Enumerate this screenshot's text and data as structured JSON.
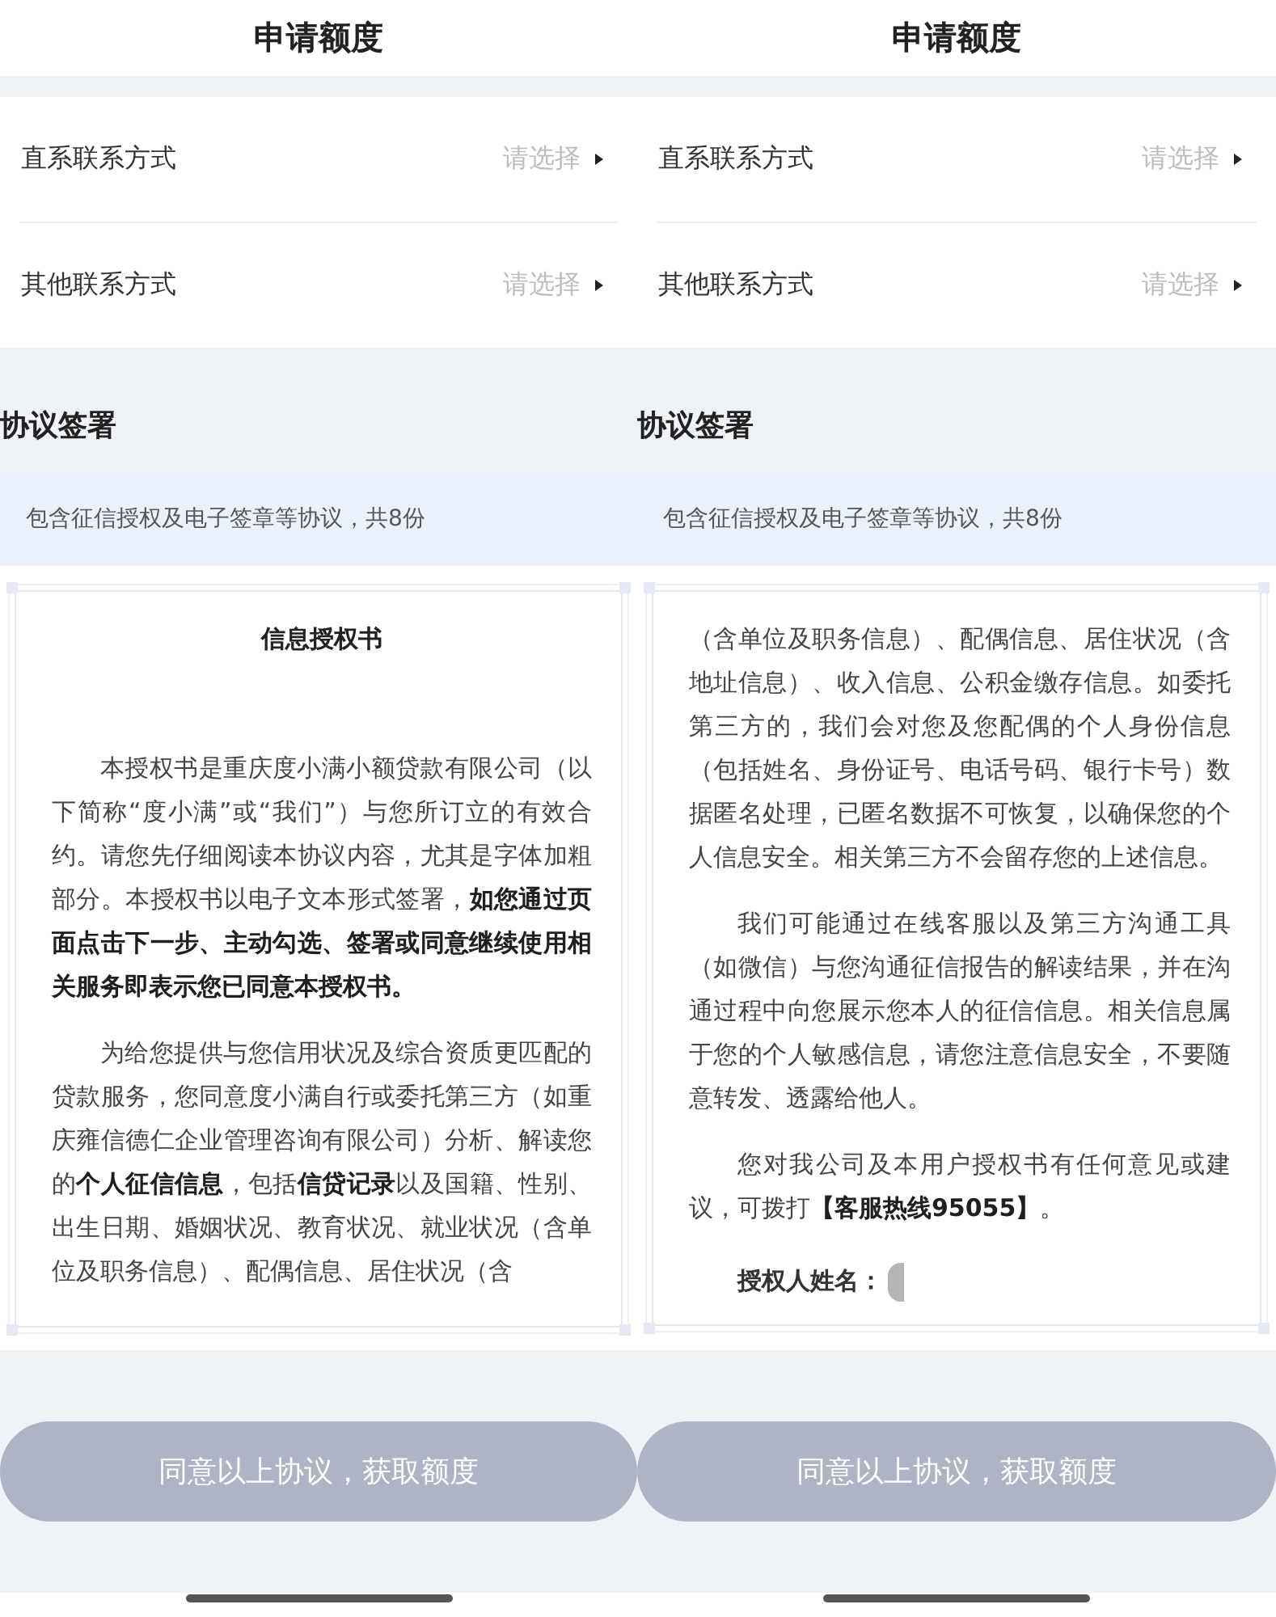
{
  "screens": [
    {
      "title": "申请额度",
      "contact_rows": [
        {
          "label": "直系联系方式",
          "placeholder": "请选择"
        },
        {
          "label": "其他联系方式",
          "placeholder": "请选择"
        }
      ],
      "section_title": "协议签署",
      "agreement_note": "包含征信授权及电子签章等协议，共8份",
      "document": {
        "title": "信息授权书",
        "paragraphs": [
          {
            "kind": "indented",
            "text": "本授权书是重庆度小满小额贷款有限公司（以下简称“度小满”或“我们”）与您所订立的有效合约。请您先仔细阅读本协议内容，尤其是字体加粗部分。本授权书以电子文本形式签署，**如您通过页面点击下一步、主动勾选、签署或同意继续使用相关服务即表示您已同意本授权书。**"
          },
          {
            "kind": "indented",
            "text": "为给您提供与您信用状况及综合资质更匹配的贷款服务，您同意度小满自行或委托第三方（如重庆雍信德仁企业管理咨询有限公司）分析、解读您的**个人征信信息**，包括**信贷记录**以及国籍、性别、出生日期、婚姻状况、教育状况、就业状况（含单位及职务信息）、配偶信息、居住状况（含"
          }
        ]
      },
      "submit_button": {
        "label": "同意以上协议，获取额度",
        "disabled": true
      }
    },
    {
      "title": "申请额度",
      "contact_rows": [
        {
          "label": "直系联系方式",
          "placeholder": "请选择"
        },
        {
          "label": "其他联系方式",
          "placeholder": "请选择"
        }
      ],
      "section_title": "协议签署",
      "agreement_note": "包含征信授权及电子签章等协议，共8份",
      "document": {
        "paragraphs": [
          {
            "kind": "continued",
            "text": "（含单位及职务信息）、配偶信息、居住状况（含地址信息）、收入信息、公积金缴存信息。如委托第三方的，我们会对您及您配偶的个人身份信息（包括姓名、身份证号、电话号码、银行卡号）数据匿名处理，已匿名数据不可恢复，以确保您的个人信息安全。相关第三方不会留存您的上述信息。"
          },
          {
            "kind": "indented",
            "text": "我们可能通过在线客服以及第三方沟通工具（如微信）与您沟通征信报告的解读结果，并在沟通过程中向您展示您本人的征信信息。相关信息属于您的个人敏感信息，请您注意信息安全，不要随意转发、透露给他人。"
          },
          {
            "kind": "indented",
            "text": "您对我公司及本用户授权书有任何意见或建议，可拨打**【客服热线95055】**。"
          }
        ],
        "signature": {
          "label": "授权人姓名：",
          "redacted": true
        }
      },
      "submit_button": {
        "label": "同意以上协议，获取额度",
        "disabled": true
      }
    }
  ]
}
